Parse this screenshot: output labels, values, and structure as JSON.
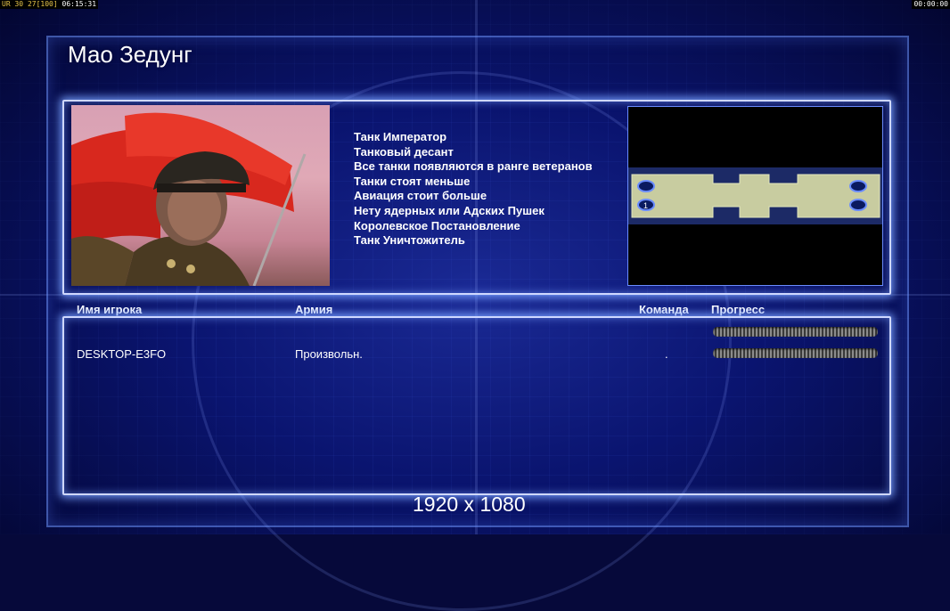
{
  "hud": {
    "fps_label": "UR",
    "fps": "30",
    "value2": "27",
    "value3": "100",
    "time": "06:15:31",
    "clock_right": "00:00:00"
  },
  "title": "Мао Зедунг",
  "traits": [
    "Танк Император",
    "Танковый десант",
    "Все танки появляются в ранге ветеранов",
    "Танки стоят меньше",
    "Авиация стоит больше",
    "Нету ядерных или Адских Пушек",
    "Королевское Постановление",
    "Танк Уничтожитель"
  ],
  "minimap": {
    "start_label": "1"
  },
  "table": {
    "headers": {
      "player": "Имя игрока",
      "army": "Армия",
      "team": "Команда",
      "progress": "Прогресс"
    },
    "rows": [
      {
        "player": "",
        "army": "",
        "team": "",
        "progress": 0
      },
      {
        "player": "DESKTOP-E3FO",
        "army": "Произвольн.",
        "team": ".",
        "progress": 0
      }
    ]
  },
  "resolution": "1920 x 1080",
  "colors": {
    "background": "#0a1470",
    "panel_glow": "#cfd8ff",
    "hud_yellow": "#e6c44a",
    "flag_red": "#d8281e"
  }
}
